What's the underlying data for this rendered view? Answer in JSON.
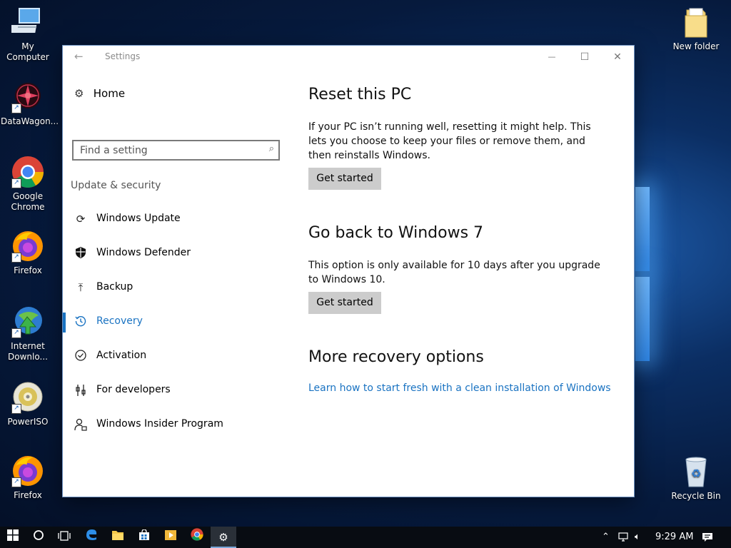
{
  "desktop": {
    "icons": [
      {
        "label": "My Computer",
        "icon": "computer-icon"
      },
      {
        "label": "DataWagon...",
        "icon": "datawagon-icon"
      },
      {
        "label": "Google Chrome",
        "icon": "chrome-icon"
      },
      {
        "label": "Firefox",
        "icon": "firefox-icon"
      },
      {
        "label": "Internet Downlo...",
        "icon": "internet-download-manager-icon"
      },
      {
        "label": "PowerISO",
        "icon": "poweriso-icon"
      },
      {
        "label": "Firefox",
        "icon": "firefox-icon"
      },
      {
        "label": "New folder",
        "icon": "folder-icon"
      },
      {
        "label": "Recycle Bin",
        "icon": "recycle-bin-icon"
      }
    ]
  },
  "window": {
    "title": "Settings",
    "back_glyph": "←",
    "min_glyph": "—",
    "max_glyph": "☐",
    "close_glyph": "✕"
  },
  "nav": {
    "home_label": "Home",
    "search_placeholder": "Find a setting",
    "section_label": "Update & security",
    "items": [
      {
        "label": "Windows Update",
        "icon": "refresh-icon"
      },
      {
        "label": "Windows Defender",
        "icon": "shield-icon"
      },
      {
        "label": "Backup",
        "icon": "upload-arrow-icon"
      },
      {
        "label": "Recovery",
        "icon": "history-icon"
      },
      {
        "label": "Activation",
        "icon": "check-circle-icon"
      },
      {
        "label": "For developers",
        "icon": "developer-tools-icon"
      },
      {
        "label": "Windows Insider Program",
        "icon": "insider-person-icon"
      }
    ],
    "active_item": "Recovery"
  },
  "content": {
    "reset": {
      "heading": "Reset this PC",
      "text": "If your PC isn’t running well, resetting it might help. This lets you choose to keep your files or remove them, and then reinstalls Windows.",
      "button": "Get started"
    },
    "goback": {
      "heading": "Go back to Windows 7",
      "text": "This option is only available for 10 days after you upgrade to Windows 10.",
      "button": "Get started"
    },
    "more": {
      "heading": "More recovery options",
      "link": "Learn how to start fresh with a clean installation of Windows"
    }
  },
  "taskbar": {
    "items": [
      "start-icon",
      "cortana-icon",
      "task-view-icon",
      "edge-icon",
      "file-explorer-icon",
      "store-icon",
      "media-player-icon",
      "chrome-icon",
      "settings-icon"
    ],
    "clock": "9:29 AM"
  },
  "colors": {
    "accent": "#1a73c2",
    "button_bg": "#cccccc",
    "taskbar": "#080c12"
  }
}
